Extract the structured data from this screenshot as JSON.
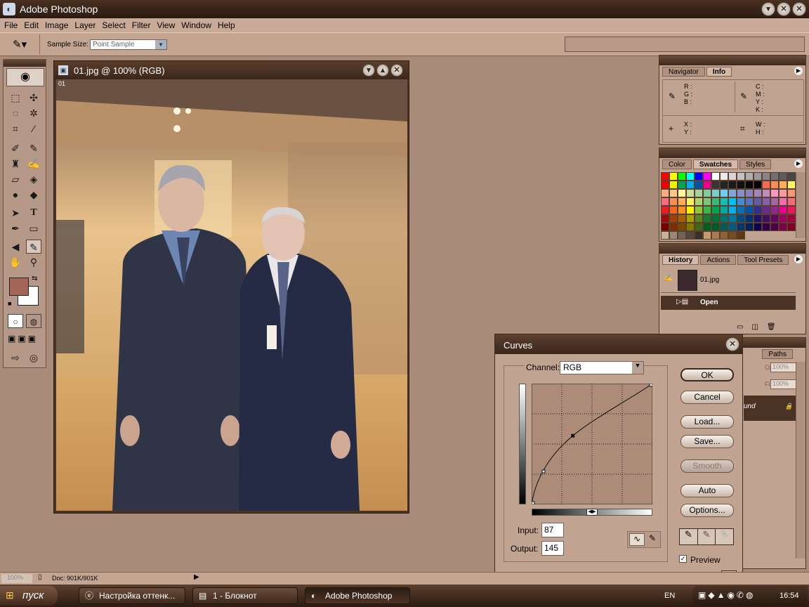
{
  "app": {
    "title": "Adobe Photoshop",
    "title_controls": [
      "▾",
      "✕",
      "✕"
    ]
  },
  "menu": [
    "File",
    "Edit",
    "Image",
    "Layer",
    "Select",
    "Filter",
    "View",
    "Window",
    "Help"
  ],
  "options": {
    "sample_size_label": "Sample Size:",
    "sample_size_value": "Point Sample"
  },
  "document": {
    "title": "01.jpg @ 100% (RGB)",
    "badge": "01"
  },
  "info_panel": {
    "tabs": [
      "Navigator",
      "Info"
    ],
    "active_tab": "Info",
    "rgb_labels": [
      "R :",
      "G :",
      "B :"
    ],
    "cmyk_labels": [
      "C :",
      "M :",
      "Y :",
      "K :"
    ],
    "xy_labels": [
      "X :",
      "Y :"
    ],
    "wh_labels": [
      "W :",
      "H :"
    ]
  },
  "swatches_panel": {
    "tabs": [
      "Color",
      "Swatches",
      "Styles"
    ],
    "active_tab": "Swatches",
    "colors": [
      "#ff0000",
      "#ffff00",
      "#00ff00",
      "#00ffff",
      "#0000ff",
      "#ff00ff",
      "#ffffff",
      "#ebebeb",
      "#d6d6d6",
      "#c2c2c2",
      "#adadad",
      "#999999",
      "#858585",
      "#707070",
      "#5c5c5c",
      "#474747",
      "#f00000",
      "#f2f200",
      "#00a651",
      "#00aeef",
      "#0054a6",
      "#ec008c",
      "#363636",
      "#242424",
      "#1a1a1a",
      "#101010",
      "#080808",
      "#000000",
      "#f26c4f",
      "#f68e56",
      "#fbaf5d",
      "#fff568",
      "#f9ad81",
      "#fdc689",
      "#fff79a",
      "#c4df9b",
      "#a3d39c",
      "#82ca9d",
      "#7bcdc8",
      "#6dcff6",
      "#7da7d9",
      "#8393ca",
      "#8781bd",
      "#a186be",
      "#bd8cbf",
      "#f49ac2",
      "#f6989d",
      "#f7977a",
      "#f26d7d",
      "#f68e55",
      "#fbaf5c",
      "#fff467",
      "#acd372",
      "#7cc576",
      "#3bb878",
      "#1abbb4",
      "#00bff3",
      "#438ccb",
      "#5574b9",
      "#605ca8",
      "#855fa8",
      "#a763a8",
      "#f06eaa",
      "#f26c7d",
      "#ed1c24",
      "#f26522",
      "#f7941d",
      "#fff200",
      "#8dc63f",
      "#39b54a",
      "#00a651",
      "#00a99d",
      "#00aeef",
      "#0072bc",
      "#0054a6",
      "#2e3192",
      "#662d91",
      "#92278f",
      "#ec008c",
      "#ed145b",
      "#9e0b0f",
      "#a0410d",
      "#a36209",
      "#aba000",
      "#598527",
      "#1a7b30",
      "#007236",
      "#00746b",
      "#0076a3",
      "#004b80",
      "#003471",
      "#1b1464",
      "#440e62",
      "#630460",
      "#9e005d",
      "#9e0039",
      "#790000",
      "#7b2e00",
      "#7d4900",
      "#827b00",
      "#406618",
      "#005e20",
      "#005826",
      "#005952",
      "#005b7f",
      "#003663",
      "#002157",
      "#0d004c",
      "#32004b",
      "#4b0049",
      "#7b0046",
      "#7a0026",
      "#c7b299",
      "#998675",
      "#736357",
      "#534741",
      "#37302d",
      "#c69c6d",
      "#a67c52",
      "#8c6239",
      "#754c24",
      "#603913"
    ]
  },
  "history_panel": {
    "tabs": [
      "History",
      "Actions",
      "Tool Presets"
    ],
    "active_tab": "History",
    "snapshot": "01.jpg",
    "steps": [
      "Open"
    ]
  },
  "layers_panel": {
    "tab": "Paths",
    "opacity_label": "Opacity:",
    "opacity_value": "100%",
    "fill_label": "Fill:",
    "fill_value": "100%",
    "layer_name": "und"
  },
  "curves": {
    "title": "Curves",
    "channel_label": "Channel:",
    "channel_value": "RGB",
    "input_label": "Input:",
    "input_value": "87",
    "output_label": "Output:",
    "output_value": "145",
    "buttons": {
      "ok": "OK",
      "cancel": "Cancel",
      "load": "Load...",
      "save": "Save...",
      "smooth": "Smooth",
      "auto": "Auto",
      "options": "Options..."
    },
    "preview_label": "Preview",
    "preview_checked": true,
    "points": [
      [
        0,
        0
      ],
      [
        87,
        145
      ],
      [
        255,
        255
      ]
    ]
  },
  "status": {
    "zoom": "100%",
    "doc": "Doc: 901K/901K"
  },
  "taskbar": {
    "start": "пуск",
    "tasks": [
      "Настройка оттенк...",
      "1 - Блокнот",
      "Adobe Photoshop"
    ],
    "active_task": "Adobe Photoshop",
    "lang": "EN",
    "time": "16:54"
  }
}
